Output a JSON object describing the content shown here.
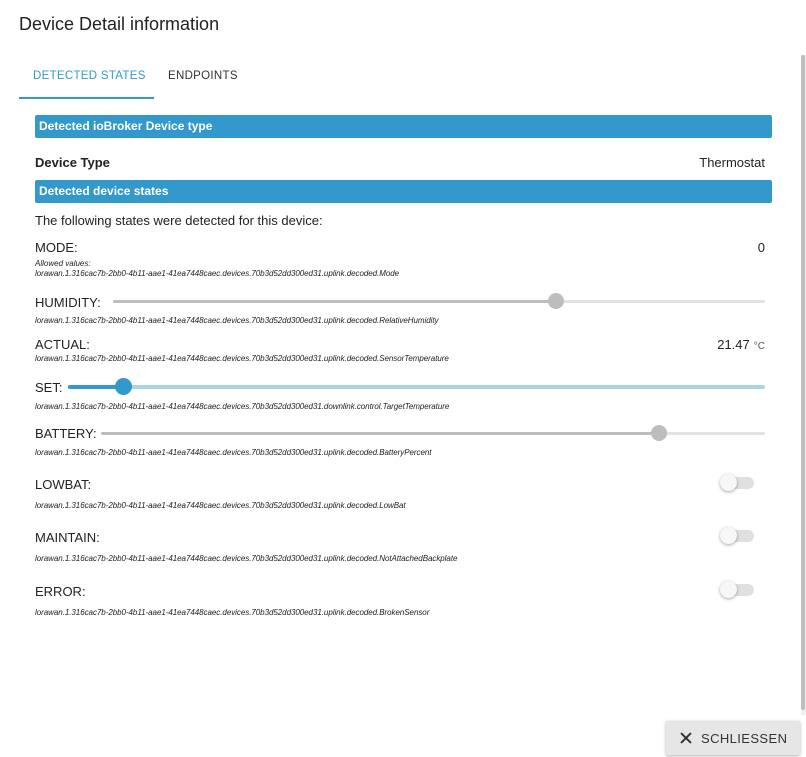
{
  "dialog": {
    "title": "Device Detail information"
  },
  "tabs": [
    {
      "label": "DETECTED STATES",
      "active": true
    },
    {
      "label": "ENDPOINTS",
      "active": false
    }
  ],
  "sections": {
    "device_type_header": "Detected ioBroker Device type",
    "device_states_header": "Detected device states"
  },
  "device_type": {
    "label": "Device Type",
    "value": "Thermostat"
  },
  "states_intro": "The following states were detected for this device:",
  "states": {
    "mode": {
      "label": "MODE:",
      "value": "0",
      "allowed_label": "Allowed values:",
      "path": "lorawan.1.316cac7b-2bb0-4b11-aae1-41ea7448caec.devices.70b3d52dd300ed31.uplink.decoded.Mode"
    },
    "humidity": {
      "label": "HUMIDITY:",
      "level": 0.68,
      "path": "lorawan.1.316cac7b-2bb0-4b11-aae1-41ea7448caec.devices.70b3d52dd300ed31.uplink.decoded.RelativeHumidity"
    },
    "actual": {
      "label": "ACTUAL:",
      "value": "21.47",
      "unit": "°C",
      "path": "lorawan.1.316cac7b-2bb0-4b11-aae1-41ea7448caec.devices.70b3d52dd300ed31.uplink.decoded.SensorTemperature"
    },
    "set": {
      "label": "SET:",
      "level": 0.08,
      "path": "lorawan.1.316cac7b-2bb0-4b11-aae1-41ea7448caec.devices.70b3d52dd300ed31.downlink.control.TargetTemperature"
    },
    "battery": {
      "label": "BATTERY:",
      "level": 0.84,
      "path": "lorawan.1.316cac7b-2bb0-4b11-aae1-41ea7448caec.devices.70b3d52dd300ed31.uplink.decoded.BatteryPercent"
    },
    "lowbat": {
      "label": "LOWBAT:",
      "on": false,
      "path": "lorawan.1.316cac7b-2bb0-4b11-aae1-41ea7448caec.devices.70b3d52dd300ed31.uplink.decoded.LowBat"
    },
    "maintain": {
      "label": "MAINTAIN:",
      "on": false,
      "path": "lorawan.1.316cac7b-2bb0-4b11-aae1-41ea7448caec.devices.70b3d52dd300ed31.uplink.decoded.NotAttachedBackplate"
    },
    "error": {
      "label": "ERROR:",
      "on": false,
      "path": "lorawan.1.316cac7b-2bb0-4b11-aae1-41ea7448caec.devices.70b3d52dd300ed31.uplink.decoded.BrokenSensor"
    }
  },
  "footer": {
    "close_label": "SCHLIESSEN",
    "close_icon": "close-icon"
  },
  "colors": {
    "accent": "#3399cc",
    "slider_disabled": "#bdbdbd",
    "set_track": "#a8d4e8"
  }
}
